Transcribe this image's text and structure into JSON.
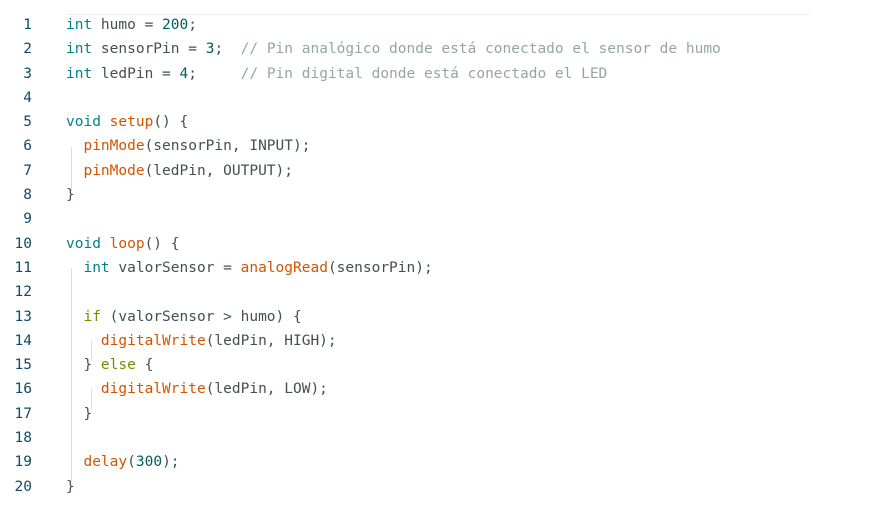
{
  "editor": {
    "lines": [
      {
        "n": "1",
        "tokens": [
          {
            "t": "int",
            "c": "type"
          },
          {
            "t": " humo = ",
            "c": "plain"
          },
          {
            "t": "200",
            "c": "num"
          },
          {
            "t": ";",
            "c": "plain"
          }
        ]
      },
      {
        "n": "2",
        "tokens": [
          {
            "t": "int",
            "c": "type"
          },
          {
            "t": " sensorPin = ",
            "c": "plain"
          },
          {
            "t": "3",
            "c": "num"
          },
          {
            "t": ";  ",
            "c": "plain"
          },
          {
            "t": "// Pin analógico donde está conectado el sensor de humo",
            "c": "com"
          }
        ]
      },
      {
        "n": "3",
        "tokens": [
          {
            "t": "int",
            "c": "type"
          },
          {
            "t": " ledPin = ",
            "c": "plain"
          },
          {
            "t": "4",
            "c": "num"
          },
          {
            "t": ";     ",
            "c": "plain"
          },
          {
            "t": "// Pin digital donde está conectado el LED",
            "c": "com"
          }
        ]
      },
      {
        "n": "4",
        "tokens": []
      },
      {
        "n": "5",
        "tokens": [
          {
            "t": "void",
            "c": "type"
          },
          {
            "t": " ",
            "c": "plain"
          },
          {
            "t": "setup",
            "c": "fn"
          },
          {
            "t": "() {",
            "c": "plain"
          }
        ]
      },
      {
        "n": "6",
        "tokens": [
          {
            "t": "  ",
            "c": "plain"
          },
          {
            "t": "pinMode",
            "c": "fn"
          },
          {
            "t": "(sensorPin, INPUT);",
            "c": "plain"
          }
        ]
      },
      {
        "n": "7",
        "tokens": [
          {
            "t": "  ",
            "c": "plain"
          },
          {
            "t": "pinMode",
            "c": "fn"
          },
          {
            "t": "(ledPin, OUTPUT);",
            "c": "plain"
          }
        ]
      },
      {
        "n": "8",
        "tokens": [
          {
            "t": "}",
            "c": "plain"
          }
        ]
      },
      {
        "n": "9",
        "tokens": []
      },
      {
        "n": "10",
        "tokens": [
          {
            "t": "void",
            "c": "type"
          },
          {
            "t": " ",
            "c": "plain"
          },
          {
            "t": "loop",
            "c": "fn"
          },
          {
            "t": "() {",
            "c": "plain"
          }
        ]
      },
      {
        "n": "11",
        "tokens": [
          {
            "t": "  ",
            "c": "plain"
          },
          {
            "t": "int",
            "c": "type"
          },
          {
            "t": " valorSensor = ",
            "c": "plain"
          },
          {
            "t": "analogRead",
            "c": "fn"
          },
          {
            "t": "(sensorPin);",
            "c": "plain"
          }
        ]
      },
      {
        "n": "12",
        "tokens": []
      },
      {
        "n": "13",
        "tokens": [
          {
            "t": "  ",
            "c": "plain"
          },
          {
            "t": "if",
            "c": "kw"
          },
          {
            "t": " (valorSensor > humo) {",
            "c": "plain"
          }
        ]
      },
      {
        "n": "14",
        "tokens": [
          {
            "t": "    ",
            "c": "plain"
          },
          {
            "t": "digitalWrite",
            "c": "fn"
          },
          {
            "t": "(ledPin, HIGH);",
            "c": "plain"
          }
        ]
      },
      {
        "n": "15",
        "tokens": [
          {
            "t": "  } ",
            "c": "plain"
          },
          {
            "t": "else",
            "c": "kw"
          },
          {
            "t": " {",
            "c": "plain"
          }
        ]
      },
      {
        "n": "16",
        "tokens": [
          {
            "t": "    ",
            "c": "plain"
          },
          {
            "t": "digitalWrite",
            "c": "fn"
          },
          {
            "t": "(ledPin, LOW);",
            "c": "plain"
          }
        ]
      },
      {
        "n": "17",
        "tokens": [
          {
            "t": "  }",
            "c": "plain"
          }
        ]
      },
      {
        "n": "18",
        "tokens": []
      },
      {
        "n": "19",
        "tokens": [
          {
            "t": "  ",
            "c": "plain"
          },
          {
            "t": "delay",
            "c": "fn"
          },
          {
            "t": "(",
            "c": "plain"
          },
          {
            "t": "300",
            "c": "num"
          },
          {
            "t": ");",
            "c": "plain"
          }
        ]
      },
      {
        "n": "20",
        "tokens": [
          {
            "t": "}",
            "c": "plain"
          }
        ]
      }
    ]
  },
  "colors": {
    "type": "#00818a",
    "function": "#d35400",
    "keyword": "#728e00",
    "number": "#005c5f",
    "comment": "#95a5a6",
    "plain": "#434f54",
    "line_number": "#0f4b63"
  }
}
